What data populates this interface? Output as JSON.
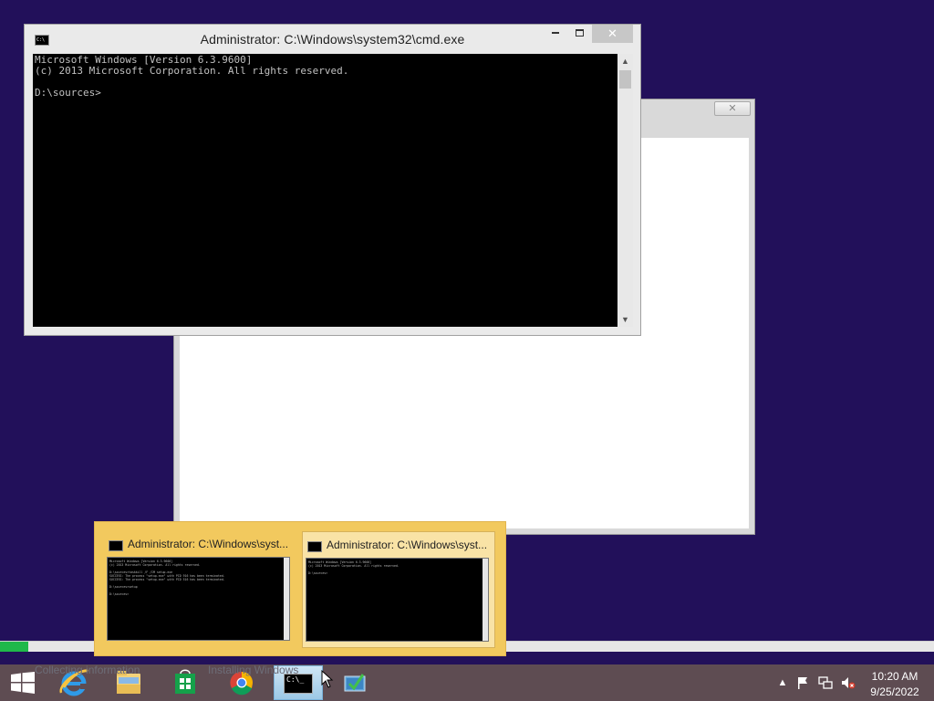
{
  "cmd_window": {
    "title": "Administrator: C:\\Windows\\system32\\cmd.exe",
    "close_glyph": "✕",
    "console_lines": [
      "Microsoft Windows [Version 6.3.9600]",
      "(c) 2013 Microsoft Corporation. All rights reserved.",
      "",
      "D:\\sources>"
    ]
  },
  "background_window": {
    "close_glyph": "✕"
  },
  "setup_status": {
    "collecting": "Collecting information",
    "installing": "Installing Windows",
    "progress_percent": 3
  },
  "thumbnails": [
    {
      "title": "Administrator: C:\\Windows\\syst...",
      "preview_lines": [
        "Microsoft Windows [Version 6.3.9600]",
        "(c) 2013 Microsoft Corporation. All rights reserved.",
        "",
        "D:\\sources>taskkill /F /IM setup.exe",
        "SUCCESS: The process \"setup.exe\" with PID 916 has been terminated.",
        "SUCCESS: The process \"setup.exe\" with PID 516 has been terminated.",
        "",
        "D:\\sources>setup",
        "",
        "D:\\sources>"
      ]
    },
    {
      "title": "Administrator: C:\\Windows\\syst...",
      "preview_lines": [
        "Microsoft Windows [Version 6.3.9600]",
        "(c) 2013 Microsoft Corporation. All rights reserved.",
        "",
        "D:\\sources>"
      ]
    }
  ],
  "taskbar": {
    "buttons": [
      "start",
      "internet-explorer",
      "file-explorer",
      "store",
      "chrome",
      "command-prompt",
      "windows-setup"
    ],
    "cmd_icon_text": "C:\\_"
  },
  "clock": {
    "time": "10:20 AM",
    "date": "9/25/2022"
  },
  "colors": {
    "desktop": "#22105a",
    "taskbar": "#5e4c52",
    "thumbnail_popup": "#f2c95e",
    "progress": "#1fb84a"
  }
}
